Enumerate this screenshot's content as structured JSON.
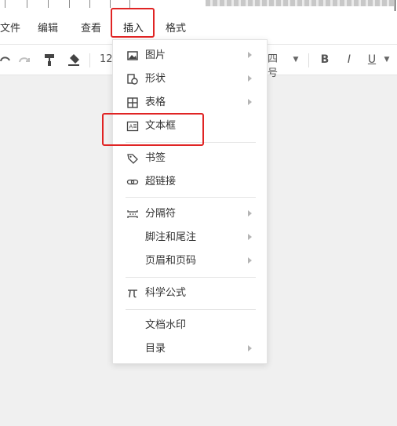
{
  "menubar": {
    "items": [
      "文件",
      "编辑",
      "查看",
      "插入",
      "格式"
    ]
  },
  "toolbar": {
    "font_size": "12",
    "font_size_name": "四号",
    "bold": "B",
    "italic": "I",
    "underline": "U"
  },
  "insert_menu": {
    "items": [
      {
        "label": "图片",
        "icon": "image-icon",
        "submenu": true
      },
      {
        "label": "形状",
        "icon": "shape-icon",
        "submenu": true
      },
      {
        "label": "表格",
        "icon": "table-icon",
        "submenu": true
      },
      {
        "label": "文本框",
        "icon": "textbox-icon",
        "submenu": false
      },
      {
        "label": "书签",
        "icon": "bookmark-icon",
        "submenu": false
      },
      {
        "label": "超链接",
        "icon": "link-icon",
        "submenu": false
      },
      {
        "label": "分隔符",
        "icon": "separator-icon",
        "submenu": true
      },
      {
        "label": "脚注和尾注",
        "icon": "",
        "submenu": true
      },
      {
        "label": "页眉和页码",
        "icon": "",
        "submenu": true
      },
      {
        "label": "科学公式",
        "icon": "formula-icon",
        "submenu": false
      },
      {
        "label": "文档水印",
        "icon": "",
        "submenu": false
      },
      {
        "label": "目录",
        "icon": "",
        "submenu": true
      }
    ]
  },
  "highlight_color": "#e02424"
}
